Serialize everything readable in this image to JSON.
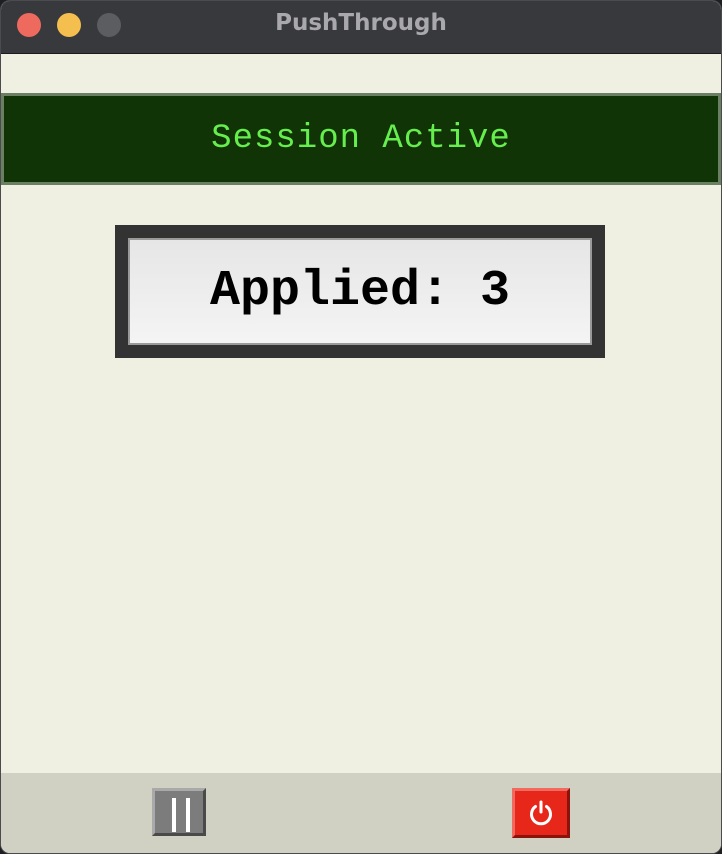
{
  "window": {
    "title": "PushThrough"
  },
  "status": {
    "text": "Session Active",
    "text_color": "#66ee4e",
    "background": "#113406"
  },
  "counter": {
    "text": "Applied: 3"
  },
  "controls": {
    "pause_icon": "pause-icon",
    "power_icon": "power-icon",
    "power_color": "#e8271b"
  }
}
